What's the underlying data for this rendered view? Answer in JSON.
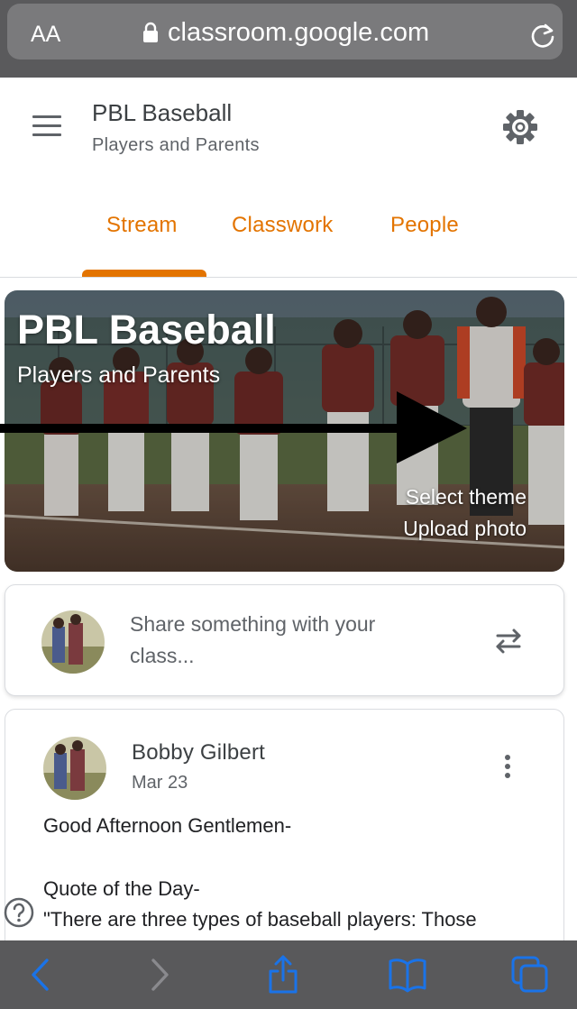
{
  "browser": {
    "text_size_label": "AA",
    "url": "classroom.google.com",
    "icons": {
      "lock": "lock-icon",
      "reload": "reload-icon"
    },
    "toolbar": {
      "icons": [
        "back-icon",
        "forward-icon",
        "share-icon",
        "bookmarks-icon",
        "tabs-icon"
      ]
    },
    "colors": {
      "bar": "#5a5a5c",
      "field": "#7a7a7c",
      "accent": "#1a73e8"
    }
  },
  "header": {
    "class_name": "PBL Baseball",
    "section": "Players and Parents",
    "icons": {
      "menu": "hamburger-menu-icon",
      "settings": "gear-icon"
    }
  },
  "tabs": [
    {
      "label": "Stream",
      "active": true
    },
    {
      "label": "Classwork",
      "active": false
    },
    {
      "label": "People",
      "active": false
    }
  ],
  "banner": {
    "title": "PBL Baseball",
    "subtitle": "Players and Parents",
    "select_theme": "Select theme",
    "upload_photo": "Upload photo"
  },
  "share": {
    "placeholder_line1": "Share something with your",
    "placeholder_line2": "class...",
    "icon": "repost-icon"
  },
  "post": {
    "author": "Bobby Gilbert",
    "date": "Mar 23",
    "lines": [
      "Good Afternoon Gentlemen-",
      "Quote of the Day-",
      "\"There are three types of baseball players: Those"
    ],
    "icon": "more-vert-icon"
  },
  "colors": {
    "accent": "#e37400",
    "text": "#202124",
    "secondary_text": "#5f6368",
    "divider": "#dadce0"
  }
}
